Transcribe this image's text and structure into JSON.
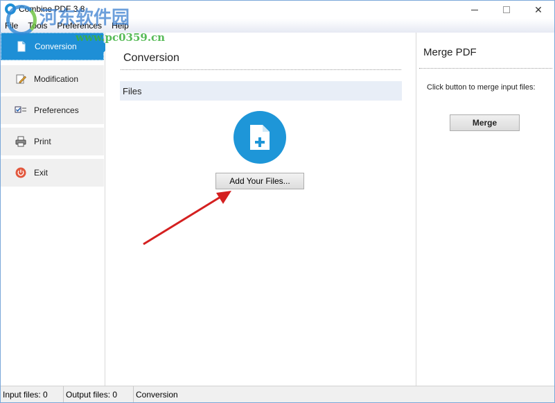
{
  "window": {
    "title": "Combine PDF 3.8",
    "controls": {
      "minimize": "minimize",
      "maximize": "maximize",
      "close": "✕"
    }
  },
  "menu": [
    "File",
    "Tools",
    "Preferences",
    "Help"
  ],
  "sidebar": {
    "items": [
      {
        "label": "Conversion",
        "icon": "document-icon",
        "active": true
      },
      {
        "label": "Modification",
        "icon": "edit-icon",
        "active": false
      },
      {
        "label": "Preferences",
        "icon": "checklist-icon",
        "active": false
      },
      {
        "label": "Print",
        "icon": "printer-icon",
        "active": false
      },
      {
        "label": "Exit",
        "icon": "power-icon",
        "active": false
      }
    ]
  },
  "main": {
    "title": "Conversion",
    "files_header": "Files",
    "add_button": "Add Your Files...",
    "add_icon": "add-file-icon"
  },
  "merge_panel": {
    "title": "Merge PDF",
    "hint": "Click button to merge input files:",
    "button": "Merge"
  },
  "status": {
    "input_files": "Input files: 0",
    "output_files": "Output files: 0",
    "mode": "Conversion"
  },
  "watermark": {
    "text": "河东软件园",
    "url": "www.pc0359.cn"
  },
  "colors": {
    "accent": "#1e8fd6",
    "files_bar": "#e8eef7",
    "arrow": "#d42020"
  }
}
